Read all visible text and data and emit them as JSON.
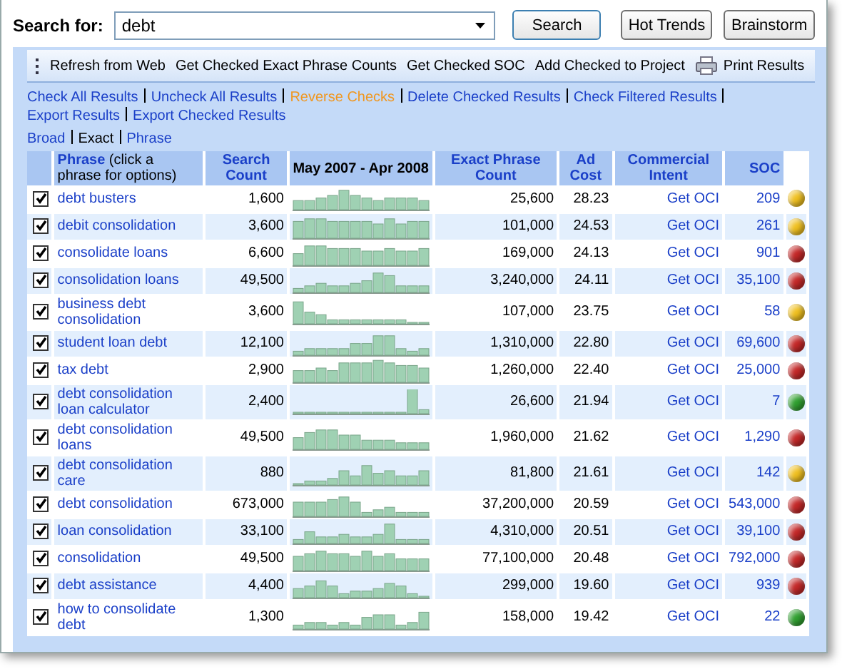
{
  "search": {
    "label": "Search for:",
    "value": "debt"
  },
  "buttons": [
    "Search",
    "Hot Trends",
    "Brainstorm"
  ],
  "toolbar": [
    {
      "label": "Refresh from Web",
      "kind": "text"
    },
    {
      "label": "Get Checked Exact Phrase Counts",
      "kind": "text"
    },
    {
      "label": "Get Checked SOC",
      "kind": "text"
    },
    {
      "label": "Add Checked to Project",
      "kind": "text"
    },
    {
      "label": "Print Results",
      "kind": "print"
    }
  ],
  "actions": [
    {
      "label": "Check All Results",
      "highlighted": false
    },
    {
      "label": "Uncheck All Results",
      "highlighted": false
    },
    {
      "label": "Reverse Checks",
      "highlighted": true
    },
    {
      "label": "Delete Checked Results",
      "highlighted": false
    },
    {
      "label": "Check Filtered Results",
      "highlighted": false
    },
    {
      "label": "Export Results",
      "highlighted": false
    },
    {
      "label": "Export Checked Results",
      "highlighted": false
    }
  ],
  "match_types": [
    {
      "label": "Broad",
      "selected": false
    },
    {
      "label": "Exact",
      "selected": true
    },
    {
      "label": "Phrase",
      "selected": false
    }
  ],
  "table": {
    "columns": [
      {
        "label": "**Phrase** (click a phrase for options)",
        "kind": "link"
      },
      {
        "label": "Search Count",
        "kind": "link"
      },
      {
        "label": "May 2007 - Apr 2008",
        "kind": "text"
      },
      {
        "label": "Exact Phrase Count",
        "kind": "link"
      },
      {
        "label": "Ad Cost",
        "kind": "link"
      },
      {
        "label": "Commercial Intent",
        "kind": "link"
      },
      {
        "label": "SOC",
        "kind": "link"
      }
    ],
    "rows": [
      {
        "checked": true,
        "phrase": "debt busters",
        "search_count": "1,600",
        "exact_count": "25,600",
        "ad_cost": "28.23",
        "intent": "Get OCI",
        "soc": "209",
        "color": "#f0c020"
      },
      {
        "checked": true,
        "phrase": "debit consolidation",
        "search_count": "3,600",
        "exact_count": "101,000",
        "ad_cost": "24.53",
        "intent": "Get OCI",
        "soc": "261",
        "color": "#f0c020"
      },
      {
        "checked": true,
        "phrase": "consolidate loans",
        "search_count": "6,600",
        "exact_count": "169,000",
        "ad_cost": "24.13",
        "intent": "Get OCI",
        "soc": "901",
        "color": "#c42828"
      },
      {
        "checked": true,
        "phrase": "consolidation loans",
        "search_count": "49,500",
        "exact_count": "3,240,000",
        "ad_cost": "24.11",
        "intent": "Get OCI",
        "soc": "35,100",
        "color": "#c42828"
      },
      {
        "checked": true,
        "phrase": "business debt consolidation",
        "search_count": "3,600",
        "exact_count": "107,000",
        "ad_cost": "23.75",
        "intent": "Get OCI",
        "soc": "58",
        "color": "#f0c020"
      },
      {
        "checked": true,
        "phrase": "student loan debt",
        "search_count": "12,100",
        "exact_count": "1,310,000",
        "ad_cost": "22.80",
        "intent": "Get OCI",
        "soc": "69,600",
        "color": "#c42828"
      },
      {
        "checked": true,
        "phrase": "tax debt",
        "search_count": "2,900",
        "exact_count": "1,260,000",
        "ad_cost": "22.40",
        "intent": "Get OCI",
        "soc": "25,000",
        "color": "#c42828"
      },
      {
        "checked": true,
        "phrase": "debt consolidation loan calculator",
        "search_count": "2,400",
        "exact_count": "26,600",
        "ad_cost": "21.94",
        "intent": "Get OCI",
        "soc": "7",
        "color": "#30a030"
      },
      {
        "checked": true,
        "phrase": "debt consolidation loans",
        "search_count": "49,500",
        "exact_count": "1,960,000",
        "ad_cost": "21.62",
        "intent": "Get OCI",
        "soc": "1,290",
        "color": "#c42828"
      },
      {
        "checked": true,
        "phrase": "debt consolidation care",
        "search_count": "880",
        "exact_count": "81,800",
        "ad_cost": "21.61",
        "intent": "Get OCI",
        "soc": "142",
        "color": "#f0c020"
      },
      {
        "checked": true,
        "phrase": "debt consolidation",
        "search_count": "673,000",
        "exact_count": "37,200,000",
        "ad_cost": "20.59",
        "intent": "Get OCI",
        "soc": "543,000",
        "color": "#c42828"
      },
      {
        "checked": true,
        "phrase": "loan consolidation",
        "search_count": "33,100",
        "exact_count": "4,310,000",
        "ad_cost": "20.51",
        "intent": "Get OCI",
        "soc": "39,100",
        "color": "#c42828"
      },
      {
        "checked": true,
        "phrase": "consolidation",
        "search_count": "49,500",
        "exact_count": "77,100,000",
        "ad_cost": "20.48",
        "intent": "Get OCI",
        "soc": "792,000",
        "color": "#c42828"
      },
      {
        "checked": true,
        "phrase": "debt assistance",
        "search_count": "4,400",
        "exact_count": "299,000",
        "ad_cost": "19.60",
        "intent": "Get OCI",
        "soc": "939",
        "color": "#c42828"
      },
      {
        "checked": true,
        "phrase": "how to consolidate debt",
        "search_count": "1,300",
        "exact_count": "158,000",
        "ad_cost": "19.42",
        "intent": "Get OCI",
        "soc": "22",
        "color": "#30a030"
      }
    ]
  }
}
